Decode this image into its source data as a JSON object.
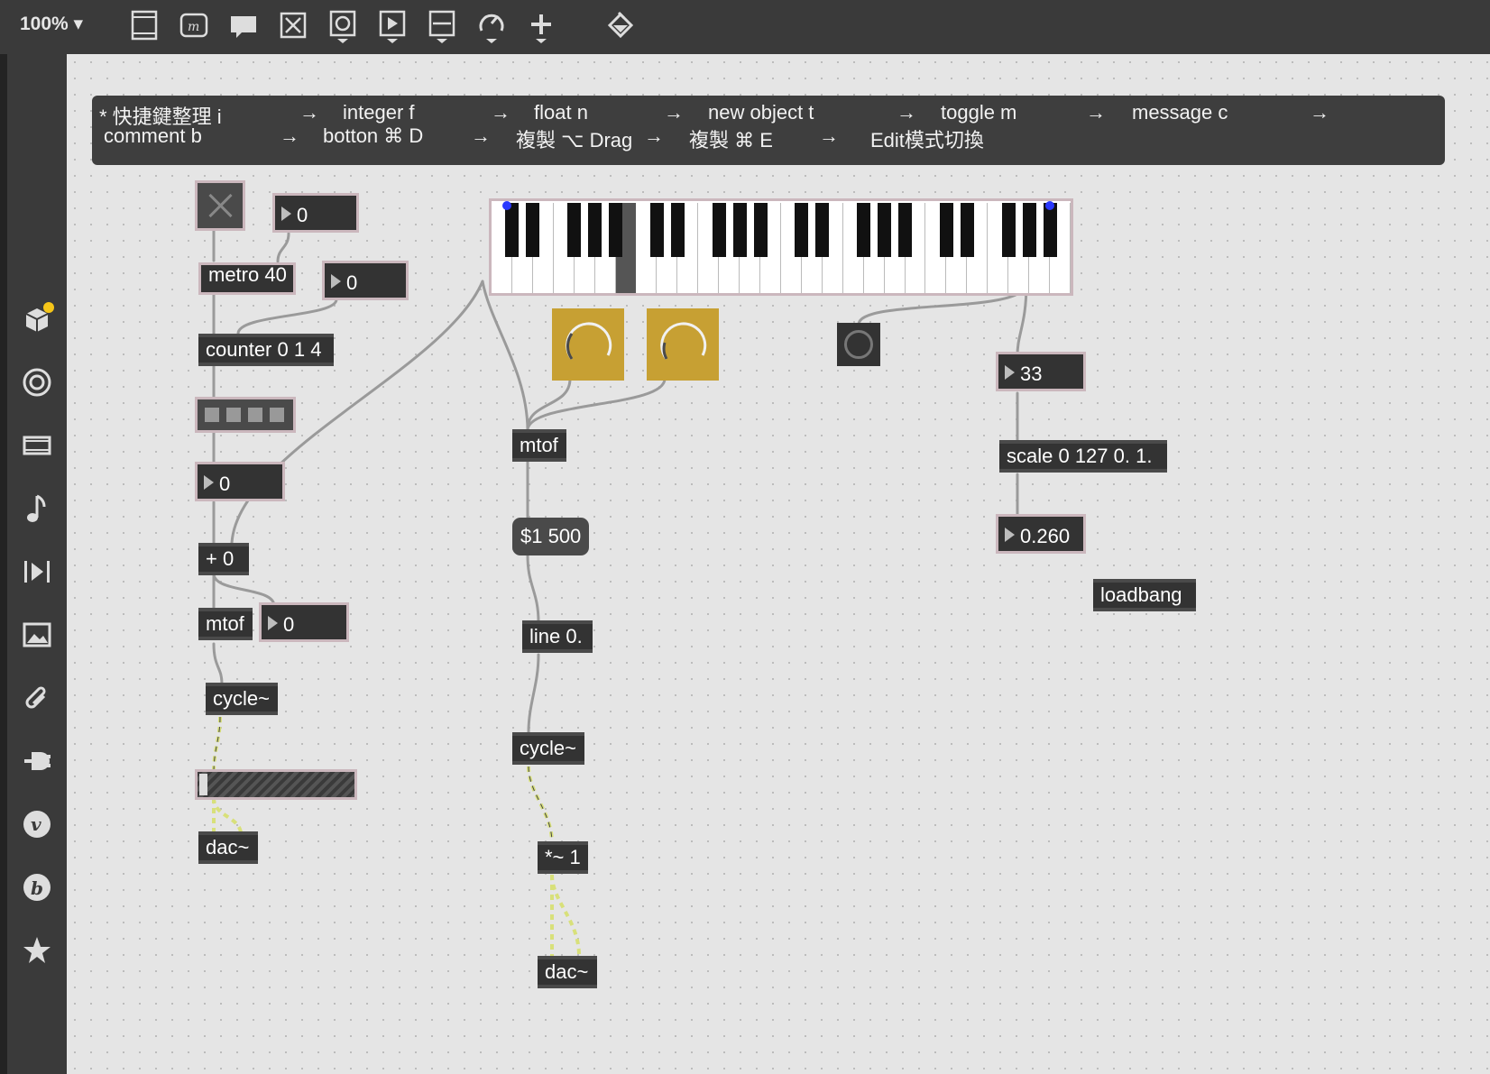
{
  "toolbar": {
    "zoom": "100% ▾",
    "buttons": [
      "new-object-icon",
      "message-icon",
      "comment-icon",
      "toggle-icon",
      "bang-icon",
      "number-icon",
      "slider-icon",
      "dial-icon",
      "add-icon",
      "paint-bucket-icon"
    ]
  },
  "sidebar": {
    "icons": [
      "package-icon",
      "target-icon",
      "film-icon",
      "music-note-icon",
      "playback-icon",
      "image-icon",
      "paperclip-icon",
      "plug-icon",
      "v-icon",
      "b-icon",
      "star-icon"
    ],
    "badge_color": "#f5c518"
  },
  "comment": {
    "line1": [
      {
        "text": "* 快捷鍵整理 i"
      },
      {
        "text": "→"
      },
      {
        "text": "integer f"
      },
      {
        "text": "→"
      },
      {
        "text": "float n"
      },
      {
        "text": "→"
      },
      {
        "text": "new object t"
      },
      {
        "text": "→"
      },
      {
        "text": "toggle m"
      },
      {
        "text": "→"
      },
      {
        "text": "message c"
      },
      {
        "text": "→"
      }
    ],
    "line2": [
      {
        "text": "comment b"
      },
      {
        "text": "→"
      },
      {
        "text": "botton ⌘ D"
      },
      {
        "text": "→"
      },
      {
        "text": "複製 ⌥ Drag"
      },
      {
        "text": "→"
      },
      {
        "text": "複製 ⌘ E"
      },
      {
        "text": "→"
      },
      {
        "text": "Edit模式切換"
      }
    ]
  },
  "objects": {
    "metro": "metro 40",
    "counter": "counter 0 1 4",
    "plus": "+ 0",
    "mtof_left": "mtof",
    "cycle_left": "cycle~",
    "dac_left": "dac~",
    "mtof_mid": "mtof",
    "msg_ramp": "$1 500",
    "line": "line 0.",
    "cycle_mid": "cycle~",
    "times": "*~ 1",
    "dac_mid": "dac~",
    "scale": "scale 0 127 0. 1.",
    "loadbang": "loadbang"
  },
  "numbers": {
    "n1": "0",
    "n2": "0",
    "n3": "0",
    "n4": "0",
    "n5": "33",
    "n6": "0.260"
  },
  "colors": {
    "canvas": "#e5e5e5",
    "dial": "#c7a033",
    "selection_border": "#cbb7bd",
    "signal_cord": "#d8e07a"
  }
}
